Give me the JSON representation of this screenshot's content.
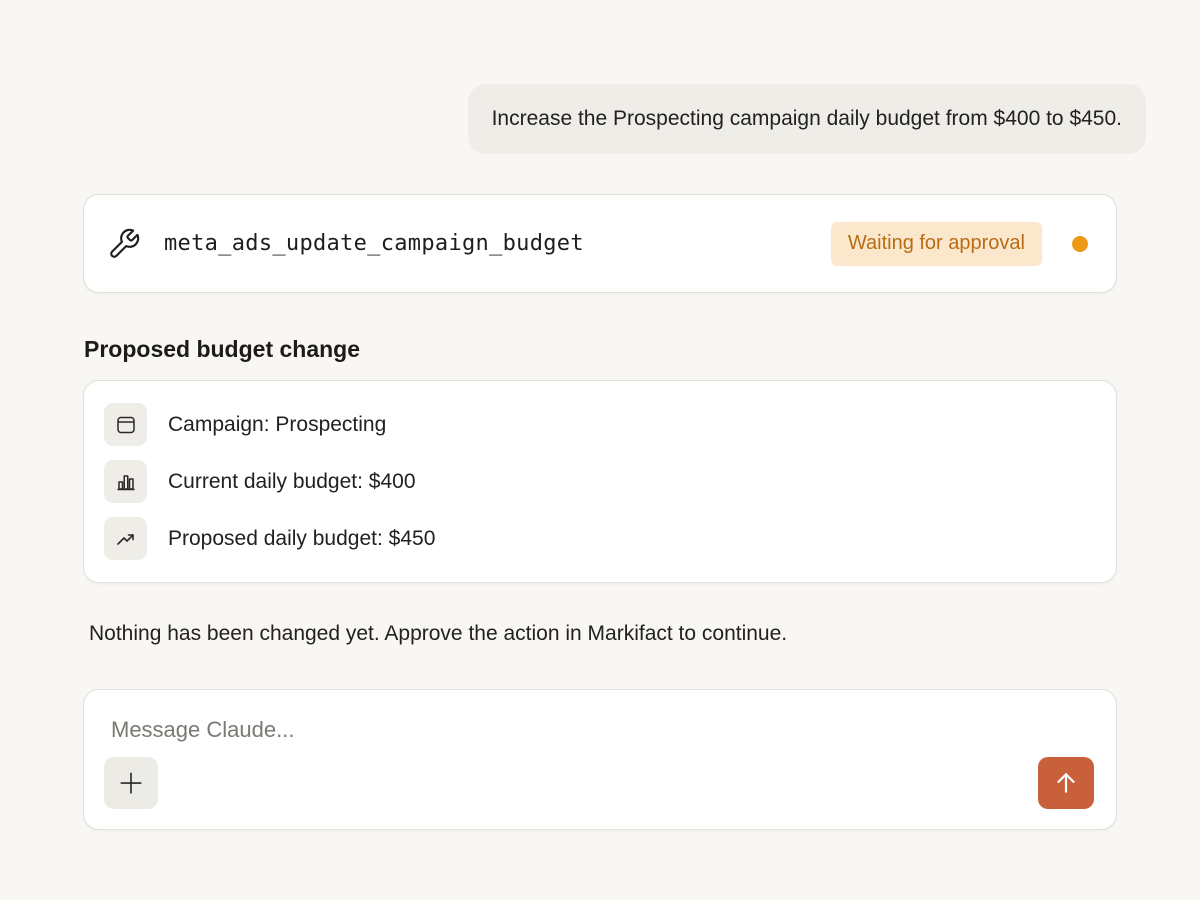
{
  "conversation": {
    "user_message": "Increase the Prospecting campaign daily budget from $400 to $450."
  },
  "tool_call": {
    "icon": "wrench-icon",
    "name": "meta_ads_update_campaign_budget",
    "status_label": "Waiting for approval",
    "status_color": "#ec9a16"
  },
  "proposal": {
    "title": "Proposed budget change",
    "rows": [
      {
        "icon": "window-icon",
        "text": "Campaign: Prospecting"
      },
      {
        "icon": "bar-chart-icon",
        "text": "Current daily budget: $400"
      },
      {
        "icon": "trending-up-icon",
        "text": "Proposed daily budget: $450"
      }
    ]
  },
  "notice": "Nothing has been changed yet. Approve the action in Markifact to continue.",
  "composer": {
    "placeholder": "Message Claude...",
    "value": "",
    "attach_icon": "plus-icon",
    "send_icon": "arrow-up-icon",
    "send_color": "#c9603c"
  }
}
